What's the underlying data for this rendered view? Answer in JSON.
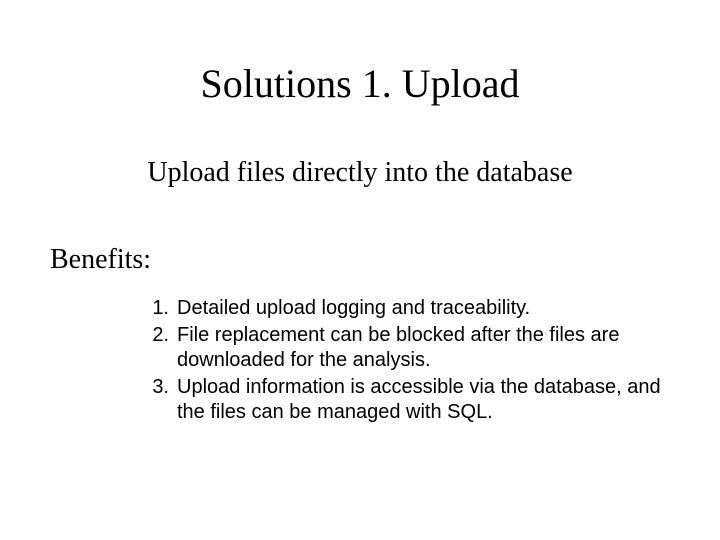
{
  "title": "Solutions 1. Upload",
  "subtitle": "Upload files directly into the database",
  "benefits_label": "Benefits:",
  "benefits": {
    "n1": "1.",
    "n2": "2.",
    "n3": "3.",
    "item1": "Detailed upload logging and traceability.",
    "item2": "File replacement can be blocked after the files are downloaded for the analysis.",
    "item3": "Upload information is accessible via the database, and the files can be managed with SQL."
  }
}
